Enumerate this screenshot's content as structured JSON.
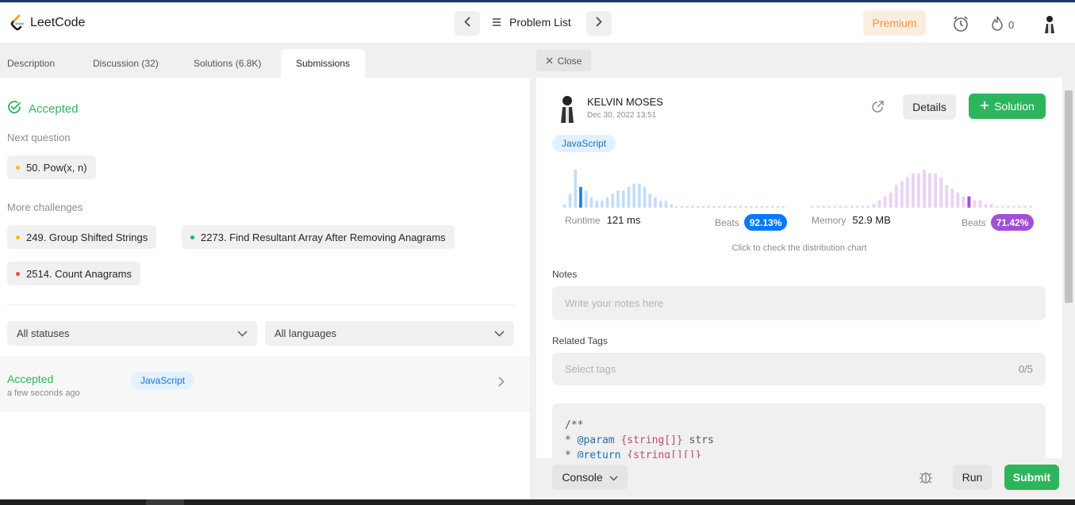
{
  "app": {
    "name": "LeetCode"
  },
  "header": {
    "problem_list_label": "Problem List",
    "premium_label": "Premium",
    "streak_count": "0"
  },
  "left_tabs": [
    {
      "label": "Description"
    },
    {
      "label": "Discussion (32)"
    },
    {
      "label": "Solutions (6.8K)"
    },
    {
      "label": "Submissions"
    }
  ],
  "result": {
    "status": "Accepted",
    "next_question_label": "Next question",
    "next_question": {
      "label": "50. Pow(x, n)",
      "difficulty_color": "#ffb800"
    },
    "more_challenges_label": "More challenges",
    "more_challenges": [
      {
        "label": "249. Group Shifted Strings",
        "difficulty_color": "#ffb800"
      },
      {
        "label": "2273. Find Resultant Array After Removing Anagrams",
        "difficulty_color": "#00af9b"
      },
      {
        "label": "2514. Count Anagrams",
        "difficulty_color": "#ef4743"
      }
    ]
  },
  "filters": {
    "status_select": "All statuses",
    "language_select": "All languages"
  },
  "submissions": [
    {
      "status": "Accepted",
      "time": "a few seconds ago",
      "language": "JavaScript"
    }
  ],
  "detail": {
    "close_label": "Close",
    "user_name": "KELVIN MOSES",
    "date": "Dec 30, 2022 13:51",
    "details_label": "Details",
    "solution_label": "Solution",
    "language": "JavaScript",
    "runtime": {
      "label": "Runtime",
      "value": "121 ms",
      "beats_label": "Beats",
      "beats": "92.13%",
      "color": "#007aff"
    },
    "memory": {
      "label": "Memory",
      "value": "52.9 MB",
      "beats_label": "Beats",
      "beats": "71.42%",
      "color": "#a34fd6"
    },
    "distribution_hint": "Click to check the distribution chart",
    "notes_label": "Notes",
    "notes_placeholder": "Write your notes here",
    "tags_label": "Related Tags",
    "tags_placeholder": "Select tags",
    "tags_count": "0/5",
    "code_lines": [
      "/**",
      " * @param {string[]} strs",
      " * @return {string[][]}"
    ]
  },
  "footer": {
    "console_label": "Console",
    "run_label": "Run",
    "submit_label": "Submit"
  },
  "runtime_distribution": [
    1,
    4,
    38,
    18,
    5,
    3,
    2,
    2,
    3,
    4,
    5,
    5,
    6,
    7,
    7,
    6,
    4,
    3,
    2,
    2,
    1,
    0.5,
    0.5,
    0.5,
    0.5,
    0.5,
    0.5,
    0.5,
    0.5,
    0.5,
    0.5,
    0.5,
    0.5,
    0.5,
    0.5,
    0.5,
    0.5,
    0.5,
    0.5,
    0.5,
    0.5,
    0.5
  ],
  "memory_distribution": [
    0.5,
    0.5,
    0.5,
    0.5,
    0.5,
    0.5,
    0.5,
    0.5,
    0.5,
    0.5,
    0.5,
    1,
    2,
    3,
    4,
    6,
    7,
    8,
    9,
    9,
    10,
    9,
    9,
    8,
    6,
    5,
    4,
    3,
    3,
    2,
    2,
    1,
    1,
    0.5,
    0.5,
    0.5,
    0.5,
    0.5,
    0.5,
    0.5
  ]
}
